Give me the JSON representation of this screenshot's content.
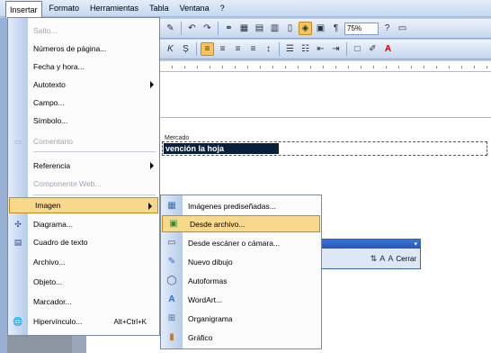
{
  "menubar": {
    "items": [
      "Insertar",
      "Formato",
      "Herramientas",
      "Tabla",
      "Ventana",
      "?"
    ],
    "active": "Insertar"
  },
  "toolbar": {
    "zoom": "75%"
  },
  "document": {
    "caption": "Mercado",
    "highlighted_text": "vención la hoja"
  },
  "insert_menu": {
    "items": [
      {
        "label": "Salto...",
        "icon": "none",
        "disabled": true
      },
      {
        "label": "Números de página...",
        "icon": "none"
      },
      {
        "label": "Fecha y hora...",
        "icon": "none"
      },
      {
        "label": "Autotexto",
        "icon": "none",
        "submenu": true
      },
      {
        "label": "Campo...",
        "icon": "none"
      },
      {
        "label": "Símbolo...",
        "icon": "none"
      },
      {
        "label": "Comentario",
        "icon": "comment-icon",
        "disabled": true
      },
      {
        "label": "Referencia",
        "icon": "none",
        "submenu": true
      },
      {
        "label": "Componente Web...",
        "icon": "none",
        "disabled": true
      },
      {
        "label": "Imagen",
        "icon": "none",
        "submenu": true,
        "highlighted": true
      },
      {
        "label": "Diagrama...",
        "icon": "diagram-icon"
      },
      {
        "label": "Cuadro de texto",
        "icon": "textbox-icon"
      },
      {
        "label": "Archivo...",
        "icon": "none"
      },
      {
        "label": "Objeto...",
        "icon": "none"
      },
      {
        "label": "Marcador...",
        "icon": "none"
      },
      {
        "label": "Hipervínculo...",
        "icon": "hyperlink-icon",
        "shortcut": "Alt+Ctrl+K"
      }
    ]
  },
  "image_submenu": {
    "items": [
      {
        "label": "Imágenes prediseñadas...",
        "icon": "clipart-icon"
      },
      {
        "label": "Desde archivo...",
        "icon": "from-file-icon",
        "highlighted": true
      },
      {
        "label": "Desde escáner o cámara...",
        "icon": "scanner-icon"
      },
      {
        "label": "Nuevo dibujo",
        "icon": "new-drawing-icon"
      },
      {
        "label": "Autoformas",
        "icon": "autoshapes-icon"
      },
      {
        "label": "WordArt...",
        "icon": "wordart-icon"
      },
      {
        "label": "Organigrama",
        "icon": "org-chart-icon"
      },
      {
        "label": "Gráfico",
        "icon": "chart-icon"
      }
    ]
  },
  "float_toolbar": {
    "close_label": "Cerrar"
  }
}
